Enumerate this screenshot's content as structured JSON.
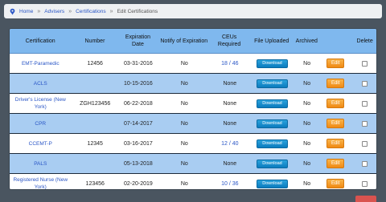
{
  "breadcrumb": {
    "items": [
      {
        "label": "Home",
        "link": true
      },
      {
        "label": "Advisers",
        "link": true
      },
      {
        "label": "Certifications",
        "link": true
      },
      {
        "label": "Edit Certifications",
        "link": false
      }
    ],
    "separator": "»"
  },
  "table": {
    "headers": {
      "certification": "Certification",
      "number": "Number",
      "expiration": "Expiration Date",
      "notify": "Notify of Expiration",
      "ceus": "CEUs Required",
      "file": "File Uploaded",
      "archived": "Archived",
      "edit": "",
      "delete": "Delete"
    },
    "rows": [
      {
        "certification": "EMT-Paramedic",
        "number": "12456",
        "expiration": "03-31-2016",
        "notify": "No",
        "ceus": "18 / 46",
        "file": "Download",
        "archived": "No",
        "edit": "Edit"
      },
      {
        "certification": "ACLS",
        "number": "",
        "expiration": "10-15-2016",
        "notify": "No",
        "ceus": "None",
        "file": "Download",
        "archived": "No",
        "edit": "Edit"
      },
      {
        "certification": "Driver's License (New York)",
        "number": "ZGH123456",
        "expiration": "06-22-2018",
        "notify": "No",
        "ceus": "None",
        "file": "Download",
        "archived": "No",
        "edit": "Edit"
      },
      {
        "certification": "CPR",
        "number": "",
        "expiration": "07-14-2017",
        "notify": "No",
        "ceus": "None",
        "file": "Download",
        "archived": "No",
        "edit": "Edit"
      },
      {
        "certification": "CCEMT-P",
        "number": "12345",
        "expiration": "03-16-2017",
        "notify": "No",
        "ceus": "12 / 40",
        "file": "Download",
        "archived": "No",
        "edit": "Edit"
      },
      {
        "certification": "PALS",
        "number": "",
        "expiration": "05-13-2018",
        "notify": "No",
        "ceus": "None",
        "file": "Download",
        "archived": "No",
        "edit": "Edit"
      },
      {
        "certification": "Registered Nurse (New York)",
        "number": "123456",
        "expiration": "02-20-2019",
        "notify": "No",
        "ceus": "10 / 36",
        "file": "Download",
        "archived": "No",
        "edit": "Edit"
      }
    ]
  },
  "icons": {
    "home": "home-icon"
  },
  "colors": {
    "header_bg": "#7fb8ee",
    "row_alt": "#a9cdf2",
    "download": "#1a8fcf",
    "edit": "#f5a02f",
    "link": "#2a56c6"
  }
}
